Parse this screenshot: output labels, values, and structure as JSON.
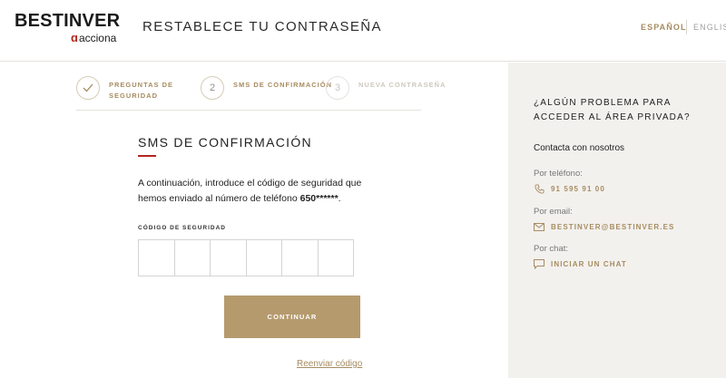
{
  "header": {
    "logo_main": "BESTINVER",
    "logo_sub": "acciona",
    "title": "RESTABLECE TU CONTRASEÑA",
    "lang_active": "ESPAÑOL",
    "lang_other": "ENGLISH"
  },
  "steps": [
    {
      "number": "✓",
      "label": "PREGUNTAS DE SEGURIDAD",
      "state": "done"
    },
    {
      "number": "2",
      "label": "SMS DE CONFIRMACIÓN",
      "state": "active"
    },
    {
      "number": "3",
      "label": "NUEVA CONTRASEÑA",
      "state": "pending"
    }
  ],
  "main": {
    "title": "SMS DE CONFIRMACIÓN",
    "desc_line1": "A continuación, introduce el código de seguridad que",
    "desc_line2_prefix": "hemos enviado al número de teléfono ",
    "phone_masked": "650******",
    "desc_line2_suffix": ".",
    "code_label": "CÓDIGO DE SEGURIDAD",
    "continue_label": "CONTINUAR",
    "resend_label": "Reenviar código"
  },
  "side": {
    "title": "¿ALGÚN PROBLEMA PARA ACCEDER AL ÁREA PRIVADA?",
    "contact_heading": "Contacta con nosotros",
    "phone_label": "Por teléfono:",
    "phone_value": "91 595 91 00",
    "email_label": "Por email:",
    "email_value": "BESTINVER@BESTINVER.ES",
    "chat_label": "Por chat:",
    "chat_value": "INICIAR UN CHAT"
  },
  "colors": {
    "accent_gold": "#b59a6d",
    "accent_red": "#b3261e",
    "side_bg": "#f3f1ee"
  }
}
